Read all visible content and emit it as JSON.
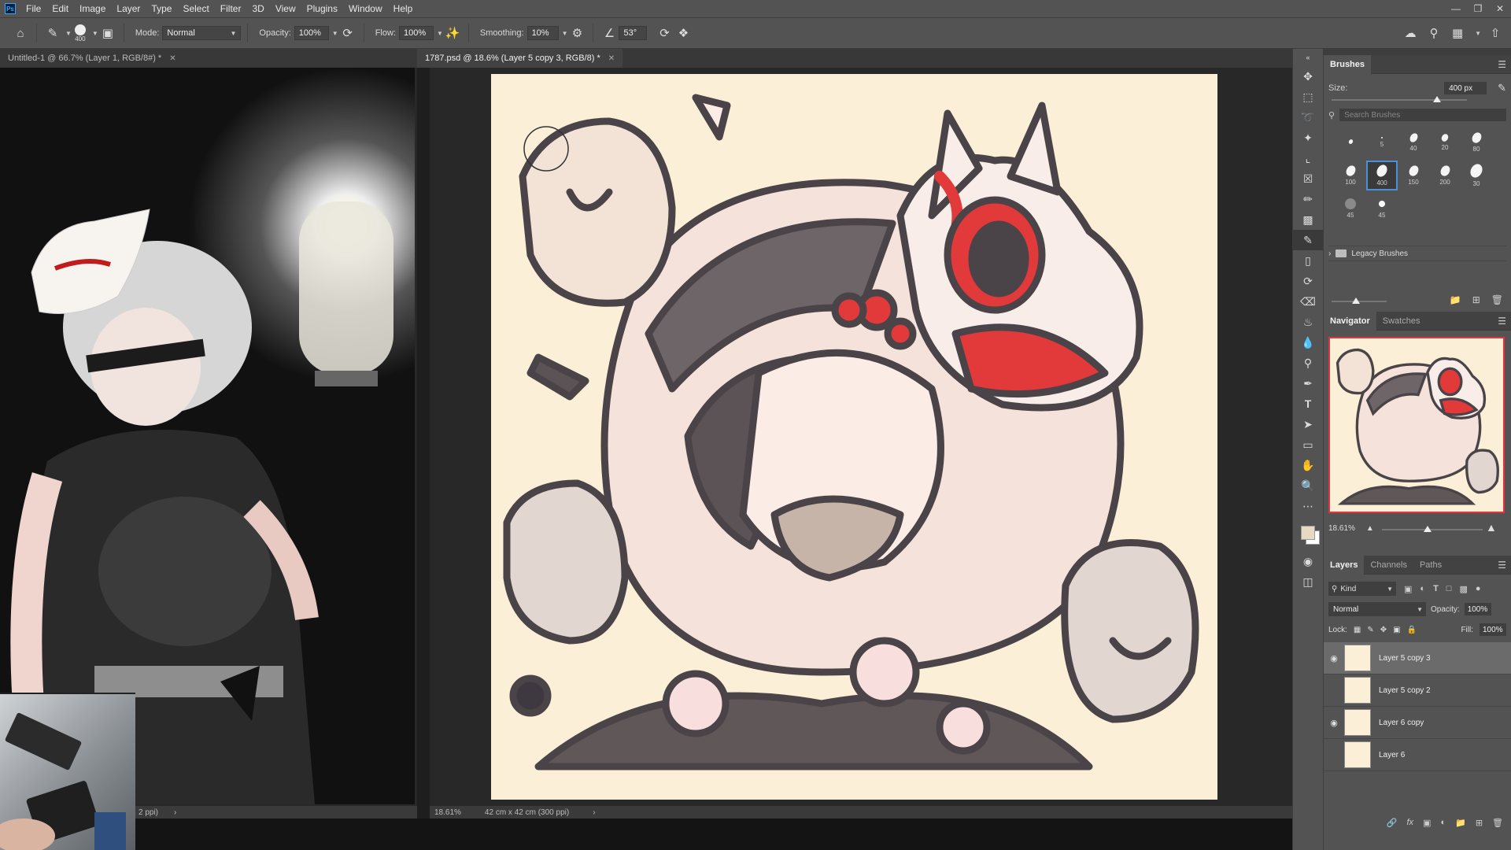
{
  "menu": {
    "items": [
      "File",
      "Edit",
      "Image",
      "Layer",
      "Type",
      "Select",
      "Filter",
      "3D",
      "View",
      "Plugins",
      "Window",
      "Help"
    ]
  },
  "options": {
    "brush_size": "400",
    "mode_label": "Mode:",
    "mode_value": "Normal",
    "opacity_label": "Opacity:",
    "opacity_value": "100%",
    "flow_label": "Flow:",
    "flow_value": "100%",
    "smoothing_label": "Smoothing:",
    "smoothing_value": "10%",
    "angle_value": "53°"
  },
  "tabs": {
    "left": "Untitled-1 @ 66.7% (Layer 1, RGB/8#) *",
    "main": "1787.psd @ 18.6% (Layer 5 copy 3, RGB/8) *"
  },
  "status": {
    "left_text": "2 ppi)",
    "zoom": "18.61%",
    "doc_size": "42 cm x 42 cm (300 ppi)"
  },
  "brushes": {
    "title": "Brushes",
    "size_label": "Size:",
    "size_value": "400 px",
    "size_fraction": 0.78,
    "search_placeholder": "Search Brushes",
    "presets": [
      {
        "size": "",
        "selected": false
      },
      {
        "size": "5",
        "selected": false
      },
      {
        "size": "40",
        "selected": false
      },
      {
        "size": "20",
        "selected": false
      },
      {
        "size": "80",
        "selected": false
      },
      {
        "size": "100",
        "selected": false
      },
      {
        "size": "400",
        "selected": true
      },
      {
        "size": "150",
        "selected": false
      },
      {
        "size": "200",
        "selected": false
      },
      {
        "size": "30",
        "selected": false
      },
      {
        "size": "45",
        "selected": false
      },
      {
        "size": "45",
        "selected": false
      }
    ],
    "legacy_folder": "Legacy Brushes"
  },
  "navigator": {
    "tabs": [
      "Navigator",
      "Swatches"
    ],
    "zoom": "18.61%",
    "zoom_fraction": 0.45
  },
  "layers": {
    "tabs": [
      "Layers",
      "Channels",
      "Paths"
    ],
    "kind_label": "Kind",
    "blend_mode": "Normal",
    "opacity_label": "Opacity:",
    "opacity_value": "100%",
    "lock_label": "Lock:",
    "fill_label": "Fill:",
    "fill_value": "100%",
    "items": [
      {
        "name": "Layer 5 copy 3",
        "visible": true,
        "selected": true
      },
      {
        "name": "Layer 5 copy 2",
        "visible": false,
        "selected": false
      },
      {
        "name": "Layer 6 copy",
        "visible": true,
        "selected": false
      },
      {
        "name": "Layer 6",
        "visible": false,
        "selected": false
      }
    ]
  },
  "colors": {
    "foreground": "#e8d9c5",
    "background": "#ffffff",
    "canvas": "#fcefd7",
    "selection_accent": "#4a8fd8",
    "navigator_frame": "#e0353d"
  }
}
